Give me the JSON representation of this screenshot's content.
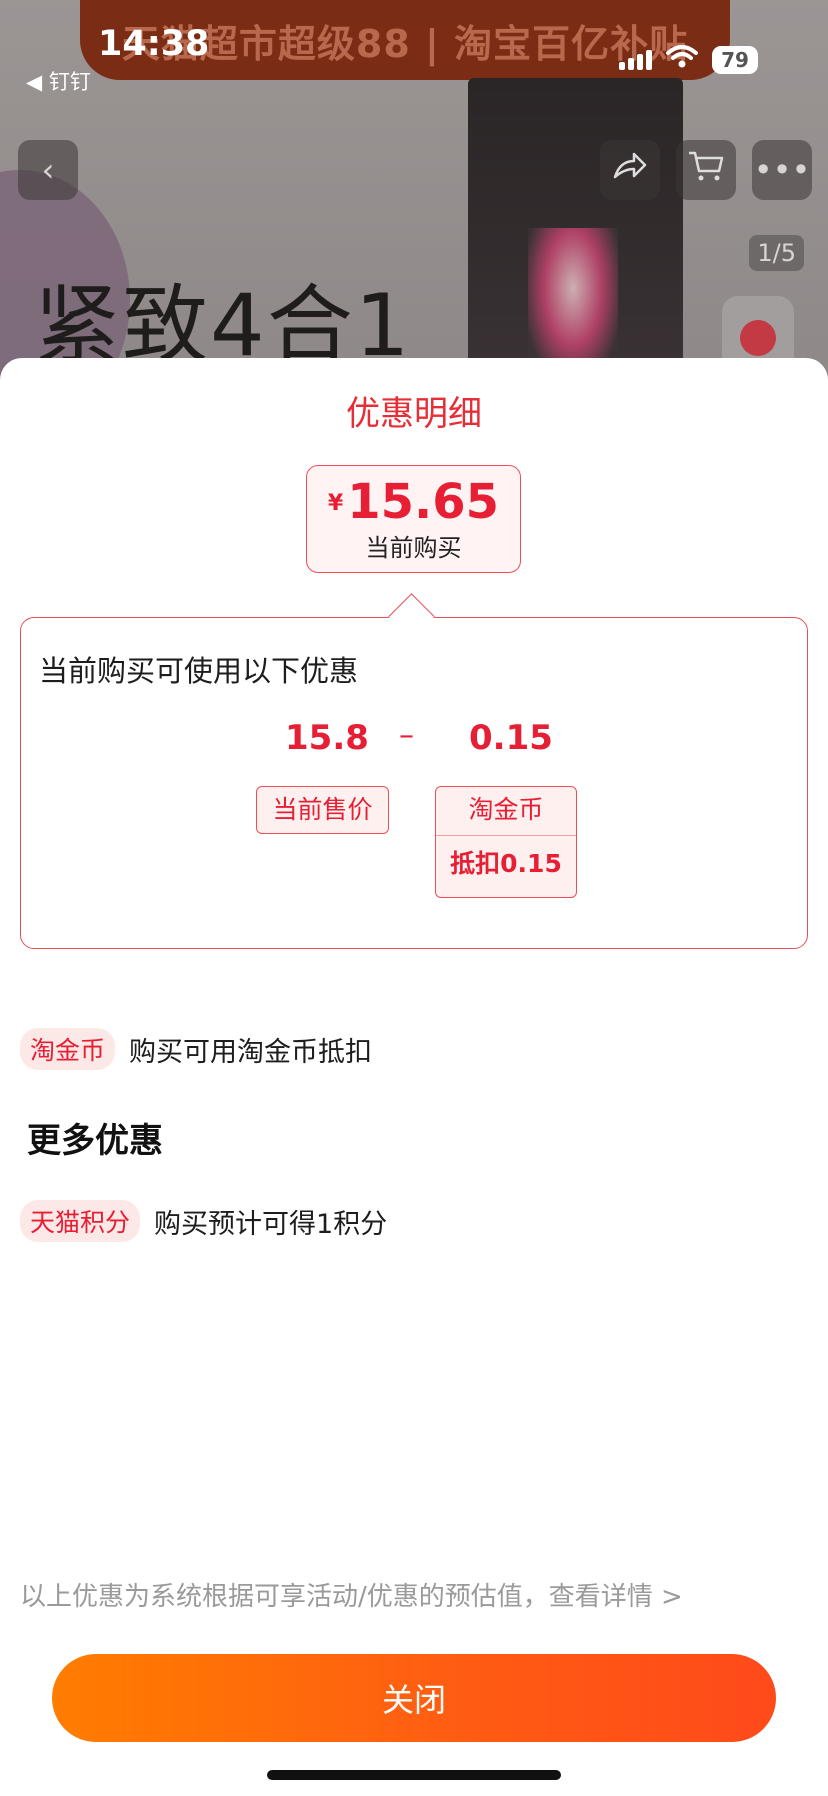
{
  "status_bar": {
    "time": "14:38",
    "back_app": "◀ 钉钉",
    "battery": "79"
  },
  "background": {
    "banner_text": "天猫超市超级88 | 淘宝百亿补贴",
    "product_title": "紧致4合1",
    "image_pager": "1/5"
  },
  "sheet": {
    "title": "优惠明细",
    "price": {
      "currency": "¥",
      "amount": "15.65",
      "caption": "当前购买"
    },
    "detail": {
      "heading": "当前购买可使用以下优惠",
      "base_value": "15.8",
      "operator": "–",
      "deduct_value": "0.15",
      "base_label": "当前售价",
      "deduct_label": "淘金币",
      "deduct_sub": "抵扣0.15"
    },
    "coin_row": {
      "tag": "淘金币",
      "text": "购买可用淘金币抵扣"
    },
    "more_title": "更多优惠",
    "points_row": {
      "tag": "天猫积分",
      "text": "购买预计可得1积分"
    },
    "footnote": "以上优惠为系统根据可享活动/优惠的预估值，查看详情 >",
    "close_label": "关闭"
  },
  "colors": {
    "accent_red": "#e61f34",
    "button_orange": "#ff6a0d"
  }
}
